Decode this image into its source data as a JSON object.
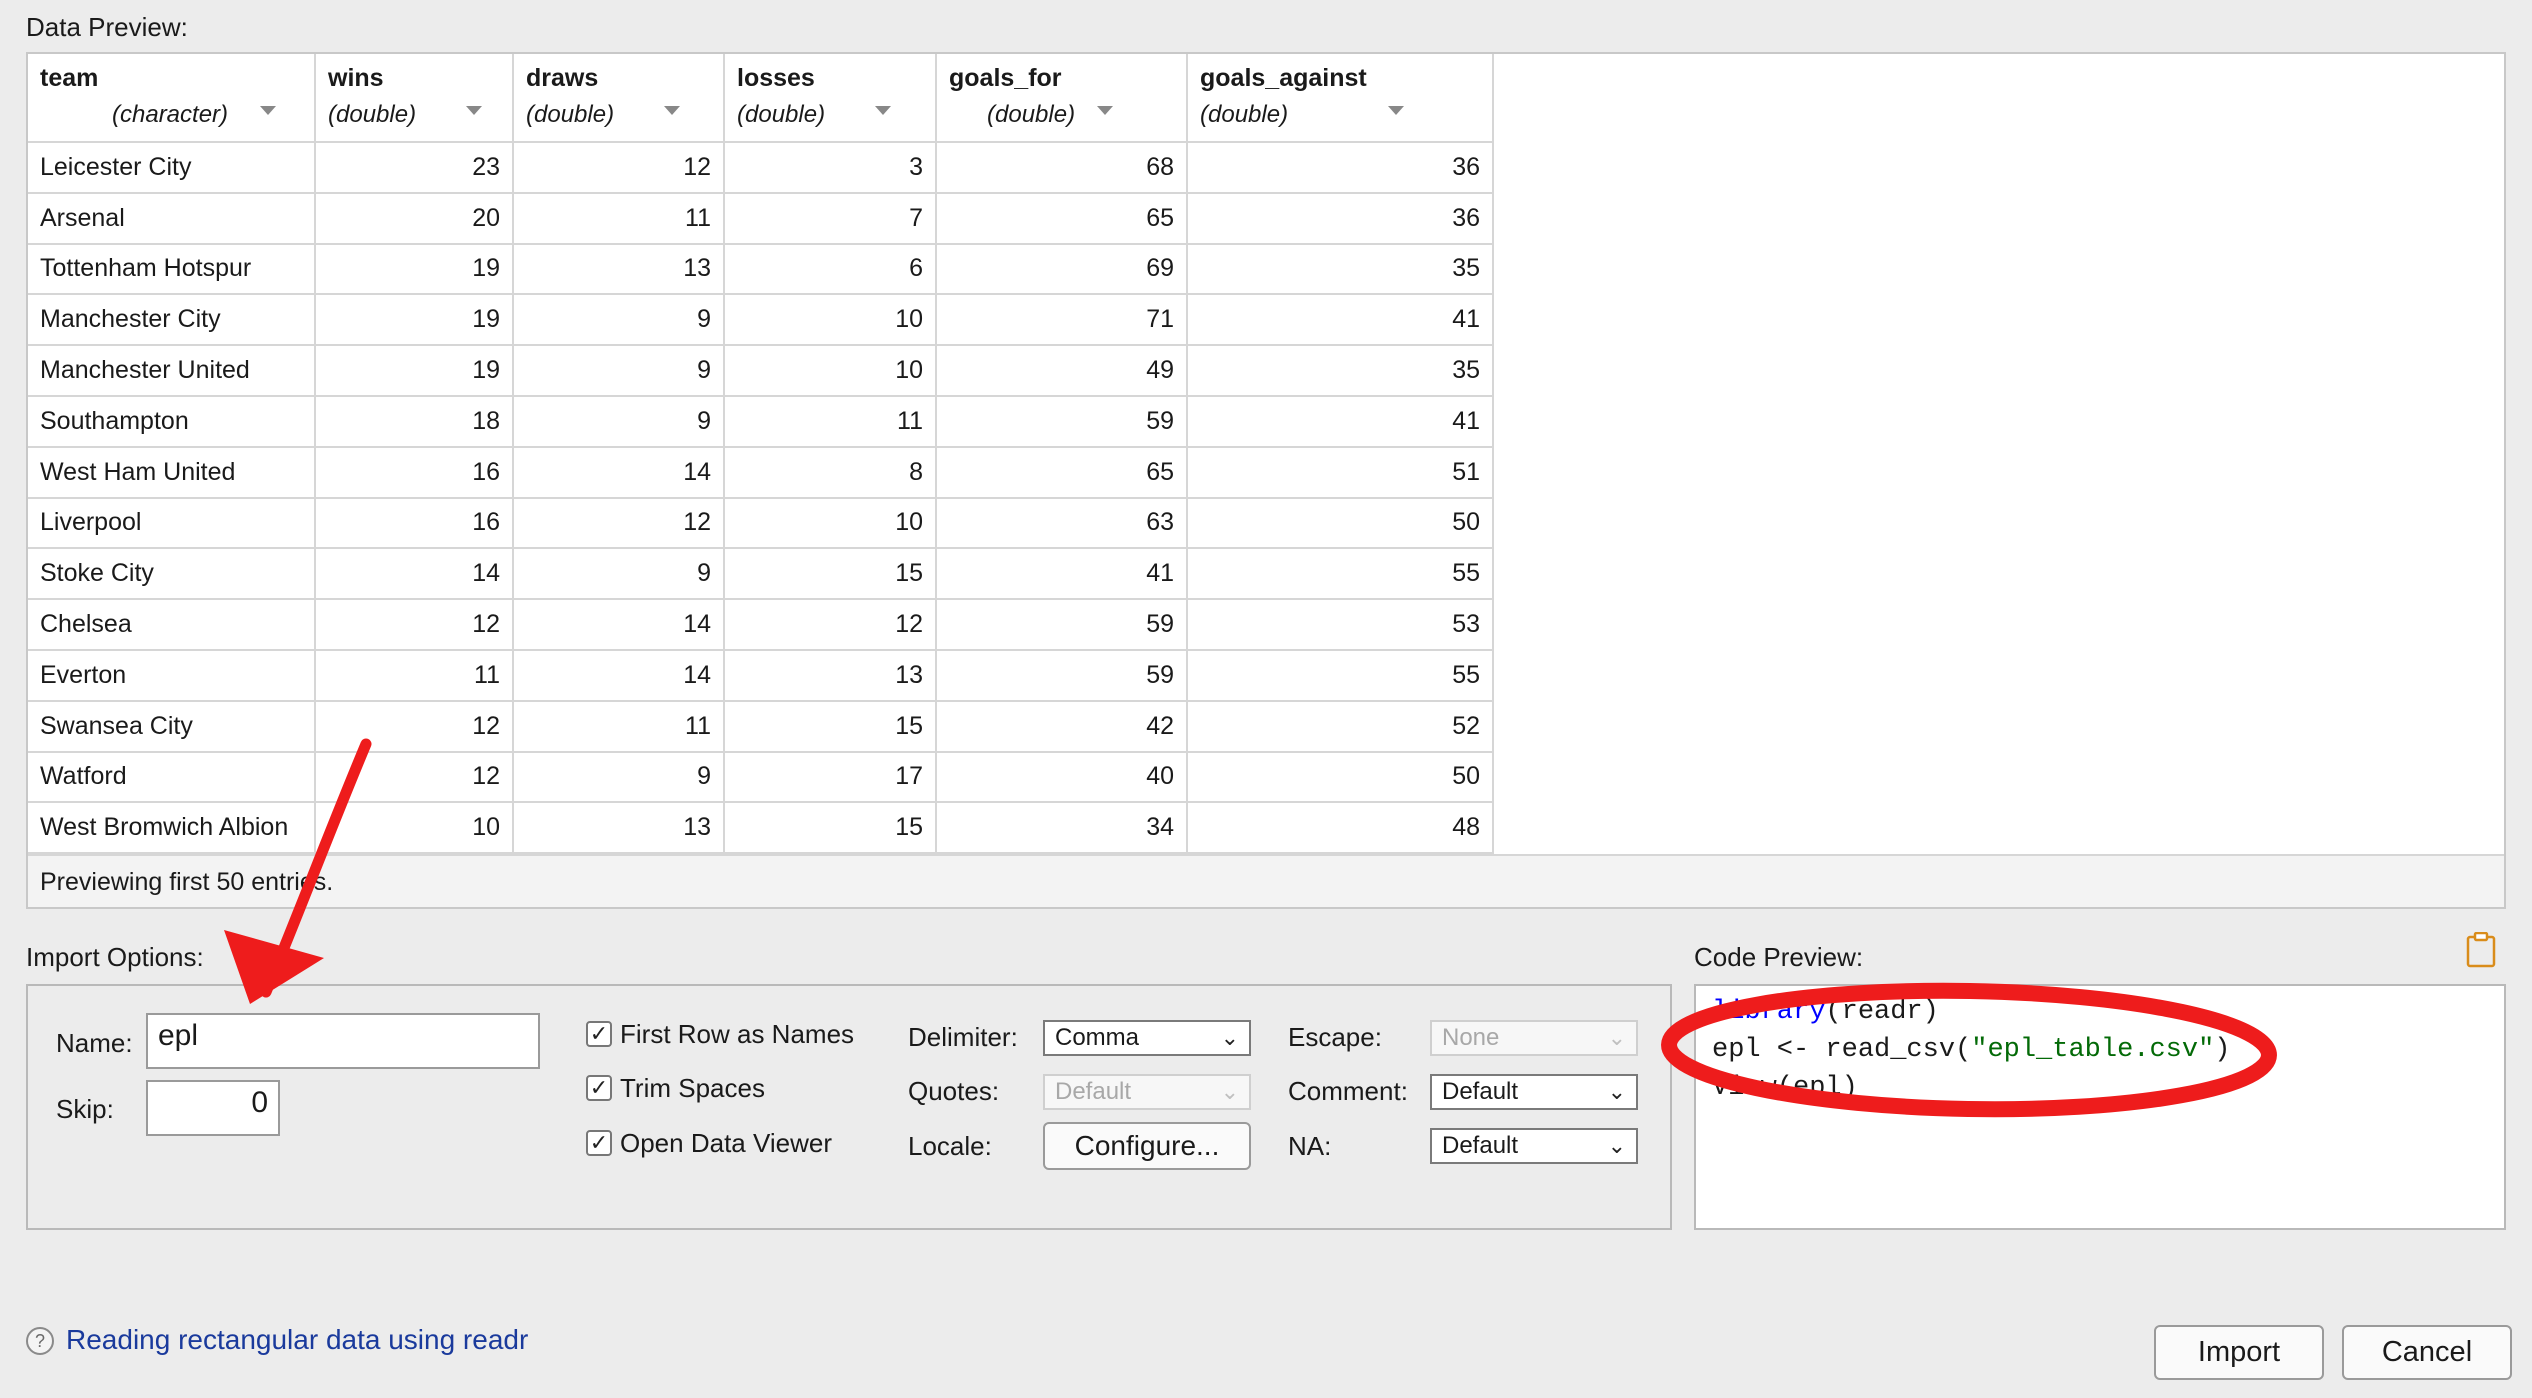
{
  "data_preview": {
    "label": "Data Preview:",
    "columns": [
      {
        "name": "team",
        "type": "(character)"
      },
      {
        "name": "wins",
        "type": "(double)"
      },
      {
        "name": "draws",
        "type": "(double)"
      },
      {
        "name": "losses",
        "type": "(double)"
      },
      {
        "name": "goals_for",
        "type": "(double)"
      },
      {
        "name": "goals_against",
        "type": "(double)"
      }
    ],
    "rows": [
      [
        "Leicester City",
        "23",
        "12",
        "3",
        "68",
        "36"
      ],
      [
        "Arsenal",
        "20",
        "11",
        "7",
        "65",
        "36"
      ],
      [
        "Tottenham Hotspur",
        "19",
        "13",
        "6",
        "69",
        "35"
      ],
      [
        "Manchester City",
        "19",
        "9",
        "10",
        "71",
        "41"
      ],
      [
        "Manchester United",
        "19",
        "9",
        "10",
        "49",
        "35"
      ],
      [
        "Southampton",
        "18",
        "9",
        "11",
        "59",
        "41"
      ],
      [
        "West Ham United",
        "16",
        "14",
        "8",
        "65",
        "51"
      ],
      [
        "Liverpool",
        "16",
        "12",
        "10",
        "63",
        "50"
      ],
      [
        "Stoke City",
        "14",
        "9",
        "15",
        "41",
        "55"
      ],
      [
        "Chelsea",
        "12",
        "14",
        "12",
        "59",
        "53"
      ],
      [
        "Everton",
        "11",
        "14",
        "13",
        "59",
        "55"
      ],
      [
        "Swansea City",
        "12",
        "11",
        "15",
        "42",
        "52"
      ],
      [
        "Watford",
        "12",
        "9",
        "17",
        "40",
        "50"
      ],
      [
        "West Bromwich Albion",
        "10",
        "13",
        "15",
        "34",
        "48"
      ]
    ],
    "footer": "Previewing first 50 entries."
  },
  "import_options": {
    "label": "Import Options:",
    "name_label": "Name:",
    "name_value": "epl",
    "skip_label": "Skip:",
    "skip_value": "0",
    "first_row_as_names": {
      "label": "First Row as Names",
      "checked": "✓"
    },
    "trim_spaces": {
      "label": "Trim Spaces",
      "checked": "✓"
    },
    "open_data_viewer": {
      "label": "Open Data Viewer",
      "checked": "✓"
    },
    "delimiter_label": "Delimiter:",
    "delimiter_value": "Comma",
    "quotes_label": "Quotes:",
    "quotes_value": "Default",
    "locale_label": "Locale:",
    "configure_label": "Configure...",
    "escape_label": "Escape:",
    "escape_value": "None",
    "comment_label": "Comment:",
    "comment_value": "Default",
    "na_label": "NA:",
    "na_value": "Default"
  },
  "code_preview": {
    "label": "Code Preview:",
    "line1_fn": "library",
    "line1_arg": "(readr)",
    "line2_prefix": "epl <- read_csv(",
    "line2_str": "\"epl_table.csv\"",
    "line2_suffix": ")",
    "line3": "View(epl)",
    "clipboard_icon": "clipboard-icon"
  },
  "footer": {
    "help_icon": "?",
    "help_link": "Reading rectangular data using readr",
    "import_label": "Import",
    "cancel_label": "Cancel"
  },
  "colors": {
    "annotation": "#ee1c1c",
    "link": "#1a3a9c",
    "keyword": "#0000ff",
    "string": "#036a07"
  }
}
